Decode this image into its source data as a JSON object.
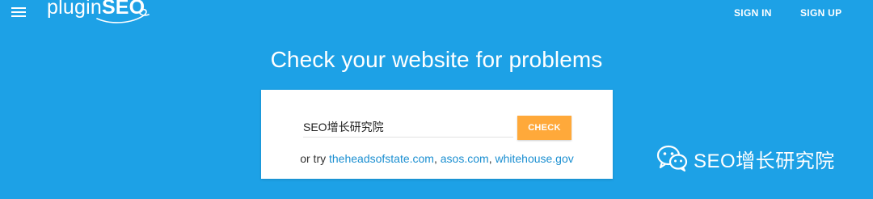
{
  "header": {
    "logo_light": "plugin",
    "logo_bold": "SEO",
    "sign_in": "SIGN IN",
    "sign_up": "SIGN UP"
  },
  "main": {
    "headline": "Check your website for problems",
    "input_value": "SEO增长研究院",
    "check_label": "CHECK",
    "try_prefix": "or try",
    "examples": [
      "theheadsofstate.com",
      "asos.com",
      "whitehouse.gov"
    ],
    "separator": ","
  },
  "watermark": {
    "text": "SEO增长研究院",
    "icon": "wechat-icon"
  },
  "colors": {
    "background": "#1da1e6",
    "accent_button": "#ffa93a",
    "link": "#1b8fd1",
    "panel": "#ffffff"
  }
}
